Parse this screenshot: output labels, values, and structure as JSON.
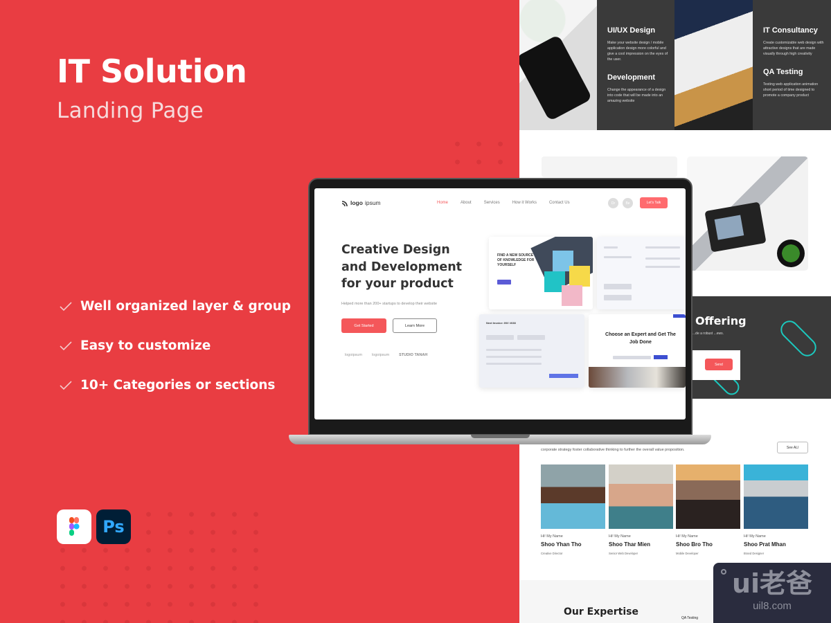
{
  "hero": {
    "title": "IT Solution",
    "subtitle": "Landing Page"
  },
  "features": [
    {
      "icon": "check-icon",
      "label": "Well organized layer & group"
    },
    {
      "icon": "check-icon",
      "label": "Easy to customize"
    },
    {
      "icon": "check-icon",
      "label": "10+ Categories or sections"
    }
  ],
  "tools": [
    {
      "name": "figma-icon",
      "label": ""
    },
    {
      "name": "photoshop-icon",
      "label": "Ps"
    }
  ],
  "colors": {
    "brand_red": "#e93d42",
    "button_red": "#f4575a",
    "dark_panel": "#3a3a3a",
    "teal_accent": "#1cc8be"
  },
  "services": [
    {
      "title": "UI/UX Design",
      "desc": "Make your website design / mobile application design more colorful and give a cool impression on the eyes of the user."
    },
    {
      "title": "Development",
      "desc": "Change the appearance of a design into code that will be made into an amazing website"
    },
    {
      "title": "IT Consultancy",
      "desc": "Create customizable web design with attractive designs that are made visually through high creativity"
    },
    {
      "title": "QA Testing",
      "desc": "Testing web application animation short period of time designed to promote a company product"
    }
  ],
  "laptop": {
    "logo_bold": "logo",
    "logo_light": "ipsum",
    "nav": [
      "Home",
      "About",
      "Services",
      "How it Works",
      "Contact Us"
    ],
    "social": [
      "Dr",
      "Be"
    ],
    "cta": "Let's Talk",
    "headline": "Creative Design and Development for your product",
    "subtext": "Helped more than 200+ startups to develop their website",
    "btn_primary": "Get Started",
    "btn_secondary": "Learn More",
    "partners": [
      "logoipsum",
      "logoipsum",
      "STUDIO TANAH"
    ],
    "thumb1_heading": "FIND A NEW SOURCE OF KNOWLEDGE FOR YOURSELF",
    "thumb3_heading": "Next Invoice: INV #038",
    "thumb4_heading": "Choose an Expert and Get The Job Done"
  },
  "offering": {
    "title": "Offering",
    "text": "...de a robust ...ews.",
    "send": "Send"
  },
  "team": {
    "intro": "corporate strategy foster collaborative thinking to further the overall value proposition.",
    "see_all": "See ALl",
    "members": [
      {
        "greet": "Hi! My Name",
        "name": "Shoo Yhan Tho",
        "role": "Creative Director"
      },
      {
        "greet": "Hi! My Name",
        "name": "Shoo Thar Mien",
        "role": "Senior Web Developer"
      },
      {
        "greet": "Hi! My Name",
        "name": "Shoo Bro Tho",
        "role": "Mobile Developer"
      },
      {
        "greet": "Hi! My Name",
        "name": "Shoo Prat Mhan",
        "role": "Brand Designer"
      }
    ]
  },
  "expertise": {
    "title": "Our Expertise",
    "item": "QA Testing"
  },
  "watermark": {
    "big": "ui老爸",
    "small": "uil8.com"
  }
}
